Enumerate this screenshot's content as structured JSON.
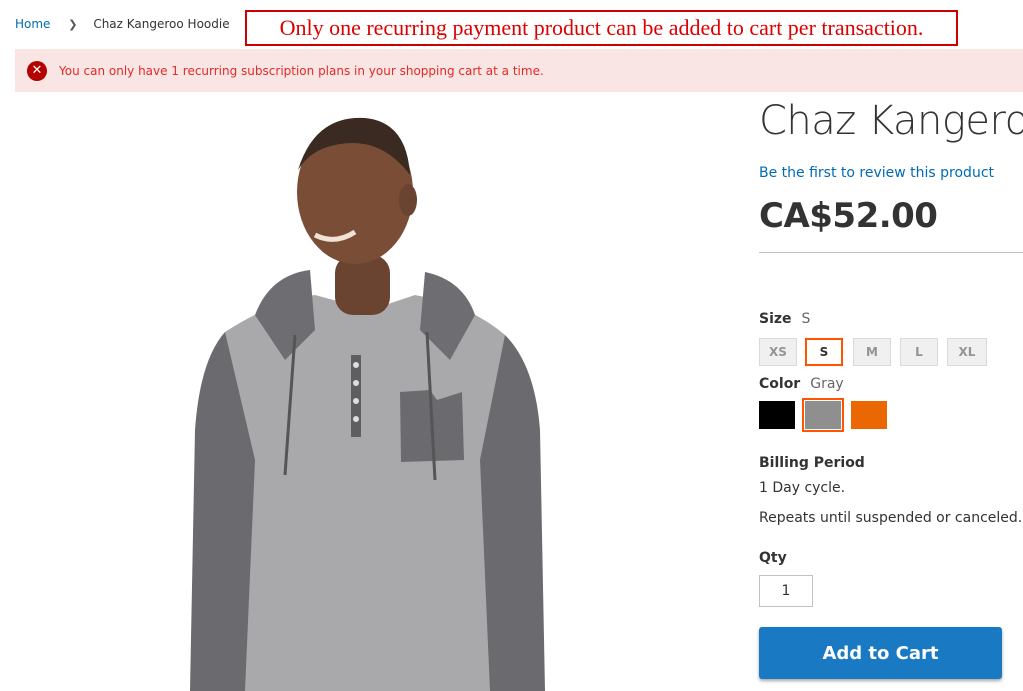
{
  "breadcrumbs": {
    "home": "Home",
    "current": "Chaz Kangeroo Hoodie"
  },
  "annotation": {
    "text": "Only one recurring payment product can be added to cart per transaction."
  },
  "error_message": {
    "text": "You can only have 1 recurring subscription plans in your shopping cart at a time."
  },
  "product": {
    "title": "Chaz Kangeroo Hoodie",
    "review_link": "Be the first to review this product",
    "price": "CA$52.00"
  },
  "options": {
    "size": {
      "label": "Size",
      "selected": "S",
      "values": [
        "XS",
        "S",
        "M",
        "L",
        "XL"
      ]
    },
    "color": {
      "label": "Color",
      "selected": "Gray",
      "swatches": [
        {
          "name": "Black",
          "hex": "#000000"
        },
        {
          "name": "Gray",
          "hex": "#8f8f8f"
        },
        {
          "name": "Orange",
          "hex": "#eb6703"
        }
      ]
    }
  },
  "billing": {
    "title": "Billing Period",
    "cycle": "1 Day cycle.",
    "repeat": "Repeats until suspended or canceled."
  },
  "qty": {
    "label": "Qty",
    "value": "1"
  },
  "add_to_cart": {
    "label": "Add to Cart"
  },
  "colors": {
    "link": "#006bb4",
    "error_bg": "#fae5e5",
    "error_text": "#e02b27",
    "primary": "#1979c3",
    "selected": "#ff5501"
  }
}
